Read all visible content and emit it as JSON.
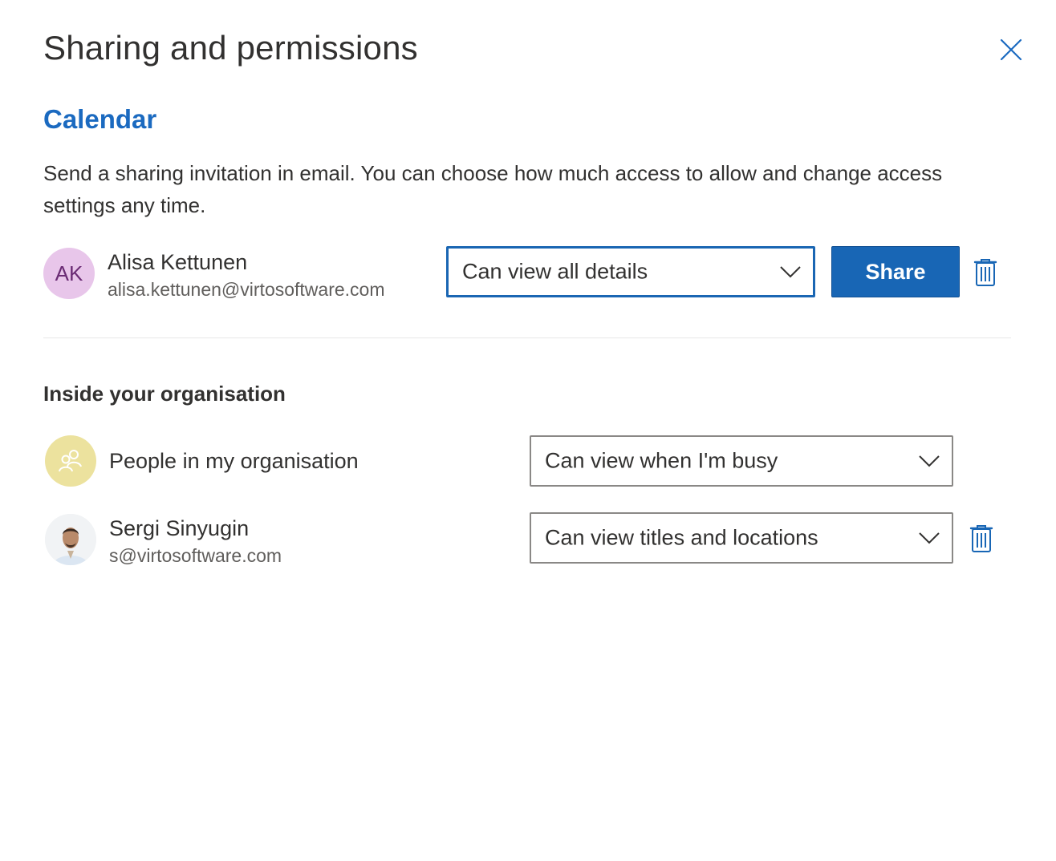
{
  "dialog": {
    "title": "Sharing and permissions",
    "close_icon": "close-icon"
  },
  "calendar": {
    "name": "Calendar",
    "description": "Send a sharing invitation in email. You can choose how much access to allow and change access settings any time."
  },
  "invite": {
    "initials": "AK",
    "name": "Alisa Kettunen",
    "email": "alisa.kettunen@virtosoftware.com",
    "permission": "Can view all details",
    "share_label": "Share"
  },
  "inside": {
    "heading": "Inside your organisation",
    "entries": [
      {
        "name": "People in my organisation",
        "permission": "Can view when I'm busy",
        "icon": "people-icon"
      },
      {
        "name": "Sergi Sinyugin",
        "email": "s@virtosoftware.com",
        "permission": "Can view titles and locations",
        "icon": "avatar-photo"
      }
    ]
  },
  "colors": {
    "accent": "#1866b5",
    "calendar_title": "#1b6ac0",
    "ak_avatar_bg": "#e8c6ea",
    "org_avatar_bg": "#ece29e"
  }
}
